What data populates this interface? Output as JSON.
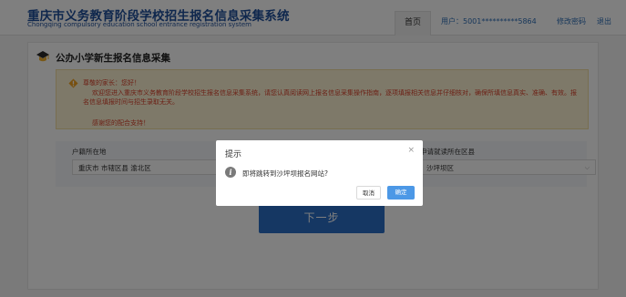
{
  "header": {
    "title_cn": "重庆市义务教育阶段学校招生报名信息采集系统",
    "title_en": "Chongqing compulsory education school entrance registration system",
    "nav_home": "首页",
    "user_label": "用户：5001**********5864",
    "change_password": "修改密码",
    "logout": "退出"
  },
  "card": {
    "title": "公办小学新生报名信息采集"
  },
  "notice": {
    "greeting": "尊敬的家长：您好！",
    "body": "欢迎您进入重庆市义务教育阶段学校招生报名信息采集系统，请您认真阅读网上报名信息采集操作指南，逐项填报相关信息并仔细核对，确保所填信息真实、准确、有效。报名信息填报时间与招生录取无关。",
    "thanks": "感谢您的配合支持！"
  },
  "form": {
    "household_label": "户籍所在地",
    "household_value": "重庆市 市辖区县 渝北区",
    "school_label": "申请就读所在区县",
    "school_value": "沙坪坝区"
  },
  "next_button": "下一步",
  "dialog": {
    "title": "提示",
    "close": "×",
    "message": "即将跳转到沙坪坝报名网站?",
    "cancel": "取消",
    "confirm": "确定"
  },
  "colors": {
    "brand": "#1e4f9b",
    "primary_button": "#2a6fc7",
    "notice_text": "#d9412b",
    "confirm_button": "#4c98e6"
  }
}
